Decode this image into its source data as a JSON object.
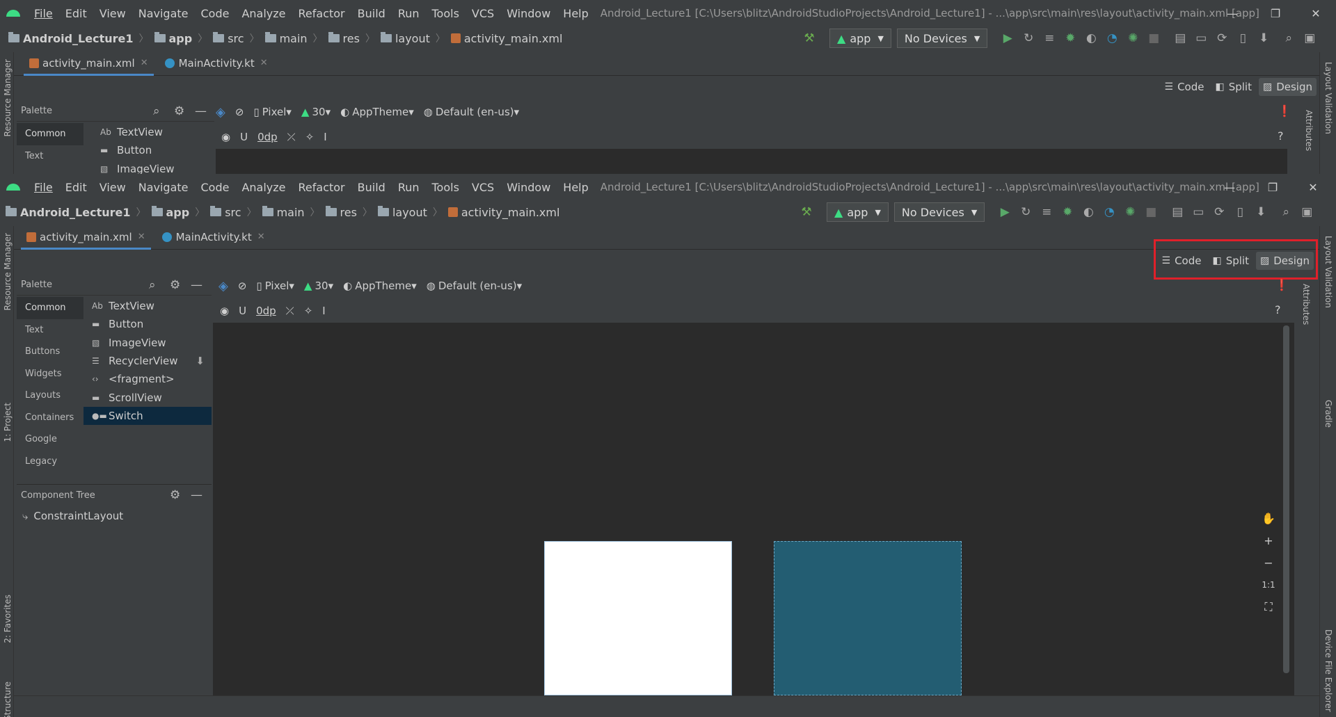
{
  "menu": {
    "items": [
      "File",
      "Edit",
      "View",
      "Navigate",
      "Code",
      "Analyze",
      "Refactor",
      "Build",
      "Run",
      "Tools",
      "VCS",
      "Window",
      "Help"
    ],
    "window_title": "Android_Lecture1 [C:\\Users\\blitz\\AndroidStudioProjects\\Android_Lecture1] - ...\\app\\src\\main\\res\\layout\\activity_main.xml [app]"
  },
  "breadcrumb": {
    "project": "Android_Lecture1",
    "module": "app",
    "src": "src",
    "main": "main",
    "res": "res",
    "layout": "layout",
    "file": "activity_main.xml"
  },
  "toolbar": {
    "run_config": "app",
    "devices": "No Devices"
  },
  "editor_tabs": [
    {
      "label": "activity_main.xml",
      "active": true
    },
    {
      "label": "MainActivity.kt",
      "active": false
    }
  ],
  "view_modes": {
    "code": "Code",
    "split": "Split",
    "design": "Design"
  },
  "design_toolbar": {
    "device": "Pixel",
    "api": "30",
    "theme": "AppTheme",
    "locale": "Default (en-us)",
    "margin": "0dp"
  },
  "palette": {
    "title": "Palette",
    "categories": [
      "Common",
      "Text",
      "Buttons",
      "Widgets",
      "Layouts",
      "Containers",
      "Google",
      "Legacy"
    ],
    "selected_category": "Common",
    "items": [
      {
        "icon": "Ab",
        "label": "TextView"
      },
      {
        "icon": "btn",
        "label": "Button"
      },
      {
        "icon": "img",
        "label": "ImageView"
      },
      {
        "icon": "list",
        "label": "RecyclerView"
      },
      {
        "icon": "<>",
        "label": "<fragment>"
      },
      {
        "icon": "scroll",
        "label": "ScrollView"
      },
      {
        "icon": "switch",
        "label": "Switch"
      }
    ],
    "selected_item": "Switch"
  },
  "component_tree": {
    "title": "Component Tree",
    "root": "ConstraintLayout"
  },
  "side_strips": {
    "left": [
      "Resource Manager",
      "1: Project",
      "2: Favorites",
      "Structure"
    ],
    "right": [
      "Layout Validation",
      "Attributes",
      "Gradle",
      "Device File Explorer"
    ]
  },
  "zoom_controls": [
    "+",
    "−",
    "1:1"
  ]
}
